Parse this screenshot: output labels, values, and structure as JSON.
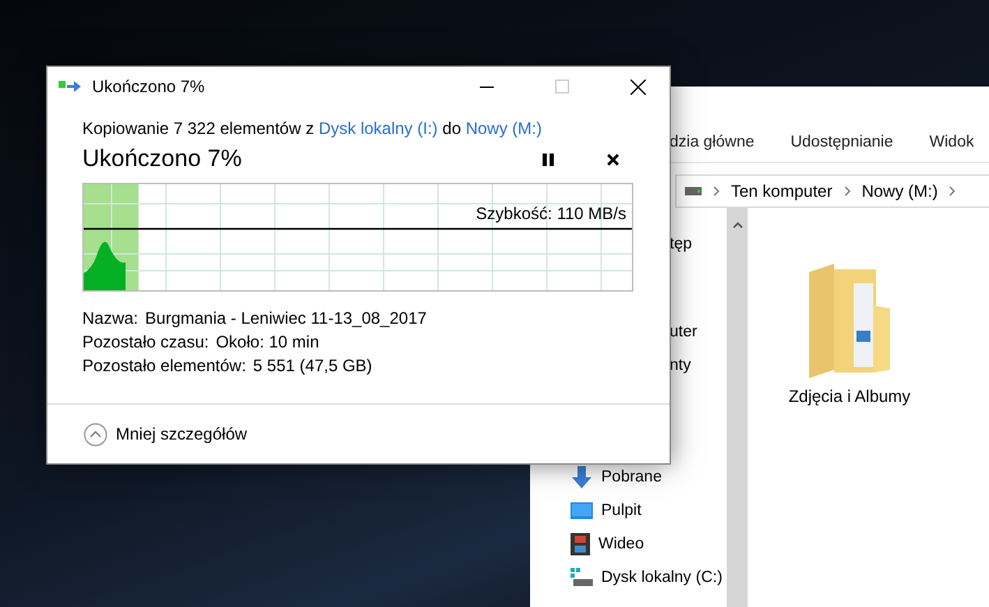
{
  "dialog": {
    "title": "Ukończono 7%",
    "summary": {
      "prefix": "Kopiowanie 7 322 elementów z ",
      "source": "Dysk lokalny (I:)",
      "middle": " do ",
      "destination": "Nowy (M:)"
    },
    "heading": "Ukończono 7%",
    "progress": {
      "level": 0.1,
      "speed": "Szybkość: 110 MB/s"
    },
    "details": [
      {
        "label": "Nazwa:",
        "value": "Burgmania - Leniwiec 11-13_08_2017"
      },
      {
        "label": "Pozostało czasu:",
        "value": "Około: 10 min"
      },
      {
        "label": "Pozostało elementów:",
        "value": "5 551 (47,5 GB)"
      }
    ],
    "toggle": "Mniej szczegółów"
  },
  "explorer": {
    "ribbon_tabs": [
      "dzia główne",
      "Udostępnianie",
      "Widok"
    ],
    "breadcrumb": [
      "Ten komputer",
      "Nowy (M:)"
    ],
    "nav_items": [
      {
        "kind": "clipped",
        "label": "tęp"
      },
      {
        "kind": "clipped",
        "label": "uter"
      },
      {
        "kind": "clipped",
        "label": "nty"
      },
      {
        "kind": "downloads",
        "label": "Pobrane"
      },
      {
        "kind": "desktop",
        "label": "Pulpit"
      },
      {
        "kind": "videos",
        "label": "Wideo"
      },
      {
        "kind": "drive",
        "label": "Dysk lokalny (C:)"
      }
    ],
    "folders": [
      {
        "name": "Zdjęcia i Albumy"
      }
    ]
  }
}
